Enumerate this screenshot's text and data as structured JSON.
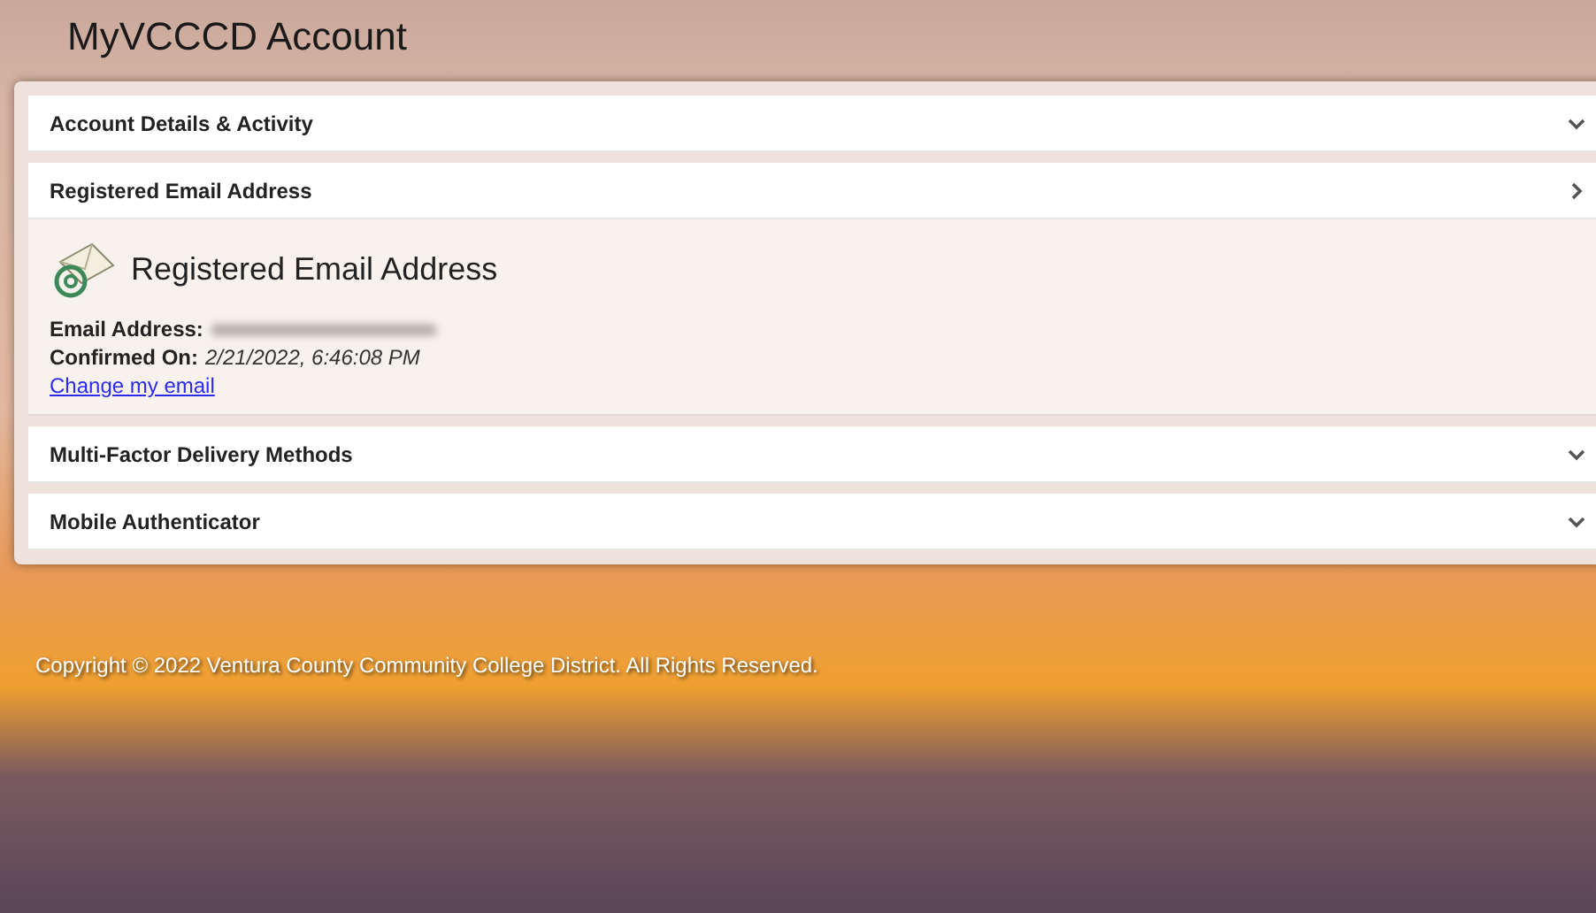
{
  "page_title": "MyVCCCD Account",
  "sections": [
    {
      "title": "Account Details & Activity",
      "expanded": false
    },
    {
      "title": "Registered Email Address",
      "expanded": true,
      "content": {
        "heading": "Registered Email Address",
        "fields": [
          {
            "label": "Email Address:",
            "value_blurred": true
          },
          {
            "label": "Confirmed On:",
            "value": "2/21/2022, 6:46:08 PM"
          }
        ],
        "link": "Change my email"
      }
    },
    {
      "title": "Multi-Factor Delivery Methods",
      "expanded": false
    },
    {
      "title": "Mobile Authenticator",
      "expanded": false
    }
  ],
  "footer": "Copyright © 2022 Ventura County Community College District. All Rights Reserved."
}
